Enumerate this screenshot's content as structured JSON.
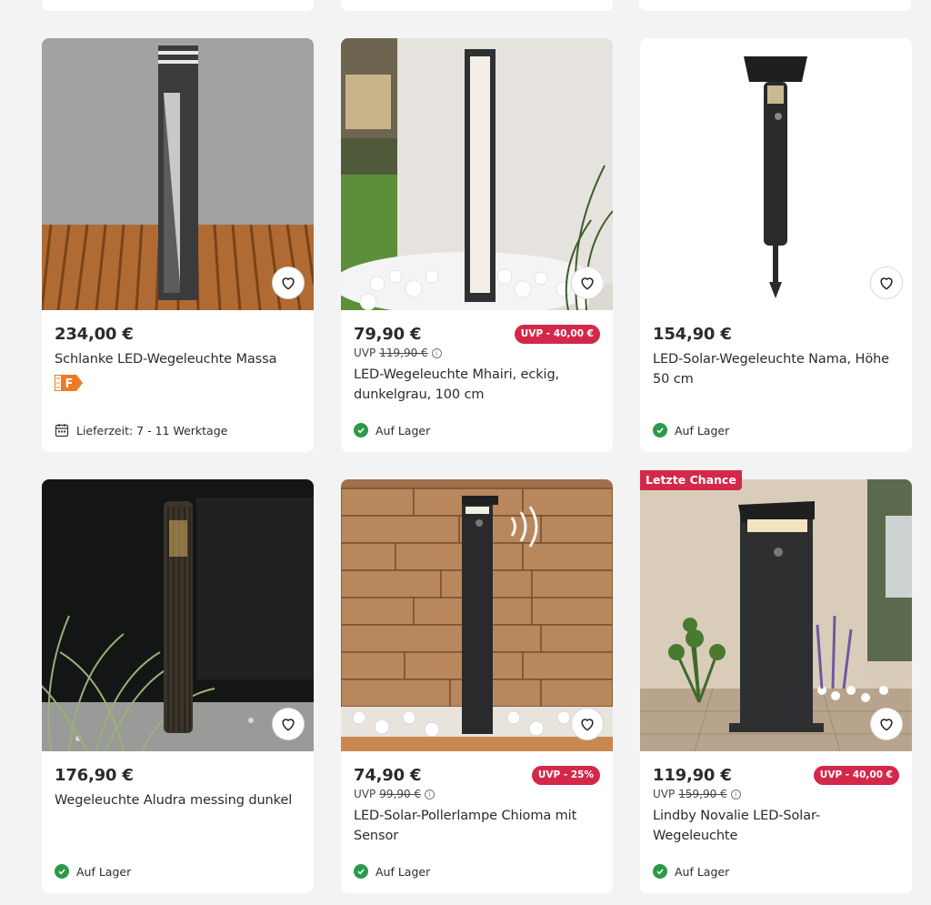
{
  "products": [
    {
      "price": "234,00 €",
      "title": "Schlanke LED-Wegeleuchte Massa",
      "energy_class": "F",
      "delivery": "Lieferzeit: 7 - 11 Werktage"
    },
    {
      "price": "79,90 €",
      "uvp_label": "UVP",
      "uvp_price": "119,90 €",
      "badge": "UVP - 40,00 €",
      "title": "LED-Wegeleuchte Mhairi, eckig, dunkelgrau, 100 cm",
      "stock": "Auf Lager"
    },
    {
      "price": "154,90 €",
      "title": "LED-Solar-Wegeleuchte Nama, Höhe 50 cm",
      "stock": "Auf Lager"
    },
    {
      "price": "176,90 €",
      "title": "Wegeleuchte Aludra messing dunkel",
      "stock": "Auf Lager"
    },
    {
      "price": "74,90 €",
      "uvp_label": "UVP",
      "uvp_price": "99,90 €",
      "badge": "UVP - 25%",
      "title": "LED-Solar-Pollerlampe Chioma mit Sensor",
      "stock": "Auf Lager"
    },
    {
      "flag": "Letzte Chance",
      "price": "119,90 €",
      "uvp_label": "UVP",
      "uvp_price": "159,90 €",
      "badge": "UVP - 40,00 €",
      "title": "Lindby Novalie LED-Solar-Wegeleuchte",
      "stock": "Auf Lager"
    }
  ],
  "colors": {
    "badge": "#d4284a",
    "stock_check": "#2b9a4a",
    "energy_f": "#ee7b22",
    "background": "#f3f3f3"
  },
  "icons": {
    "wishlist": "heart-icon",
    "stock": "check-circle-icon",
    "delivery": "calendar-icon",
    "uvp_info": "info-icon"
  }
}
